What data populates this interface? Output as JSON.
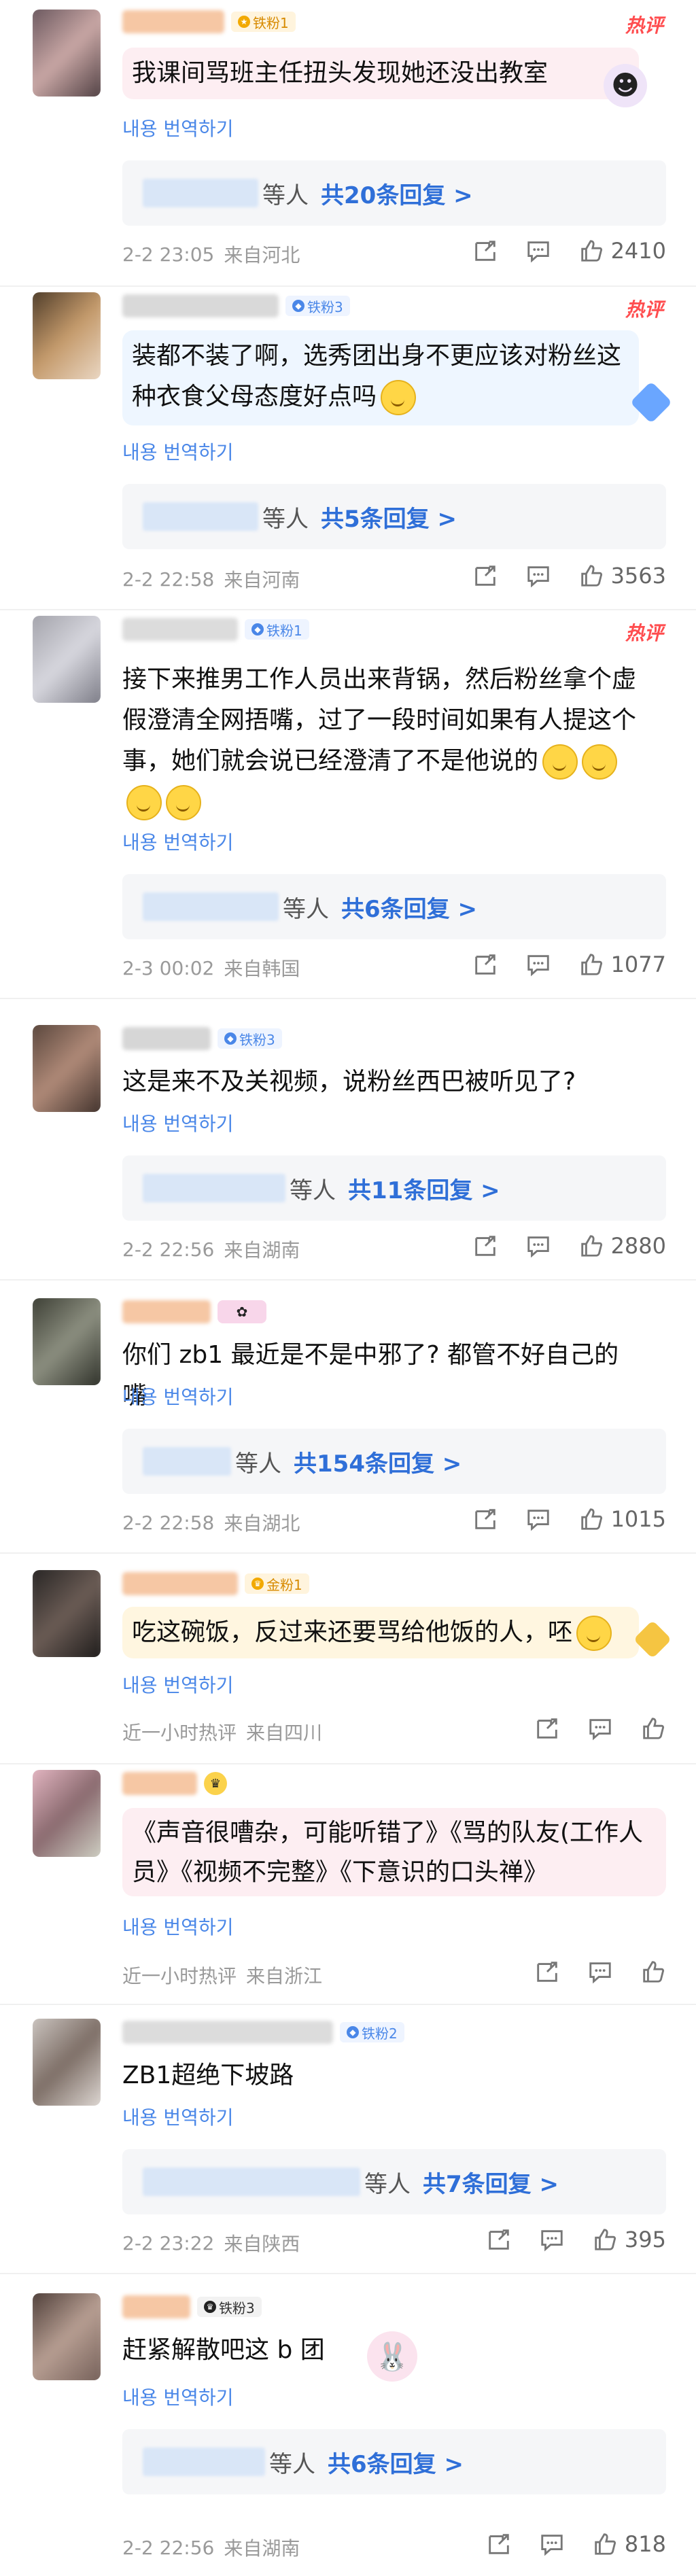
{
  "translate_label": "내용 번역하기",
  "reply_mid": "等人",
  "hot_label": "热评",
  "comments": [
    {
      "text": "我课间骂班主任扭头发现她还没出教室",
      "badge": "铁粉1",
      "hot": true,
      "reply": "共20条回复 >",
      "time": "2-2 23:05",
      "loc": "来自河北",
      "likes": "2410"
    },
    {
      "text": "装都不装了啊，选秀团出身不更应该对粉丝这种衣食父母态度好点吗",
      "badge": "铁粉3",
      "hot": true,
      "reply": "共5条回复 >",
      "time": "2-2 22:58",
      "loc": "来自河南",
      "likes": "3563"
    },
    {
      "text": "接下来推男工作人员出来背锅，然后粉丝拿个虚假澄清全网捂嘴，过了一段时间如果有人提这个事，她们就会说已经澄清了不是他说的",
      "badge": "铁粉1",
      "hot": true,
      "reply": "共6条回复 >",
      "time": "2-3 00:02",
      "loc": "来自韩国",
      "likes": "1077"
    },
    {
      "text": "这是来不及关视频，说粉丝西巴被听见了?",
      "badge": "铁粉3",
      "reply": "共11条回复 >",
      "time": "2-2 22:56",
      "loc": "来自湖南",
      "likes": "2880"
    },
    {
      "text": "你们 zb1 最近是不是中邪了? 都管不好自己的嘴",
      "reply": "共154条回复 >",
      "time": "2-2 22:58",
      "loc": "来自湖北",
      "likes": "1015"
    },
    {
      "text": "吃这碗饭，反过来还要骂给他饭的人，呸",
      "badge": "金粉1",
      "time": "近一小时热评",
      "loc": "来自四川",
      "likes": ""
    },
    {
      "text": "《声音很嘈杂，可能听错了》《骂的队友(工作人员》《视频不完整》《下意识的口头禅》",
      "time": "近一小时热评",
      "loc": "来自浙江",
      "likes": ""
    },
    {
      "text": "ZB1超绝下坡路",
      "badge": "铁粉2",
      "reply": "共7条回复 >",
      "time": "2-2 23:22",
      "loc": "来自陕西",
      "likes": "395"
    },
    {
      "text": "赶紧解散吧这 b 团",
      "badge": "铁粉3",
      "reply": "共6条回复 >",
      "time": "2-2 22:56",
      "loc": "来自湖南",
      "likes": "818"
    }
  ]
}
